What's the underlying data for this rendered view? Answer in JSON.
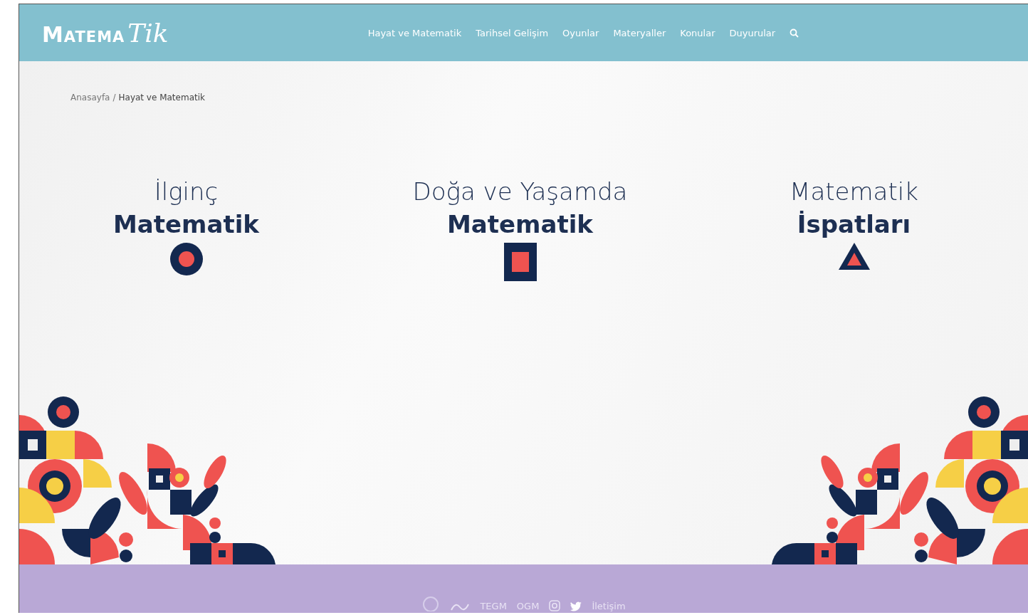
{
  "header": {
    "logo_main": "Matema",
    "logo_script": "Tik",
    "nav": [
      {
        "label": "Hayat ve Matematik"
      },
      {
        "label": "Tarihsel Gelişim"
      },
      {
        "label": "Oyunlar"
      },
      {
        "label": "Materyaller"
      },
      {
        "label": "Konular"
      },
      {
        "label": "Duyurular"
      }
    ]
  },
  "breadcrumb": {
    "home": "Anasayfa",
    "separator": "/",
    "current": "Hayat ve Matematik"
  },
  "categories": [
    {
      "line1": "İlginç",
      "line2": "Matematik",
      "kind": "circle"
    },
    {
      "line1": "Doğa ve Yaşamda",
      "line2": "Matematik",
      "kind": "square"
    },
    {
      "line1": "Matematik",
      "line2": "İspatları",
      "kind": "triangle"
    }
  ],
  "footer": {
    "links": [
      "TEGM",
      "OGM"
    ],
    "contact": "İletişim"
  }
}
